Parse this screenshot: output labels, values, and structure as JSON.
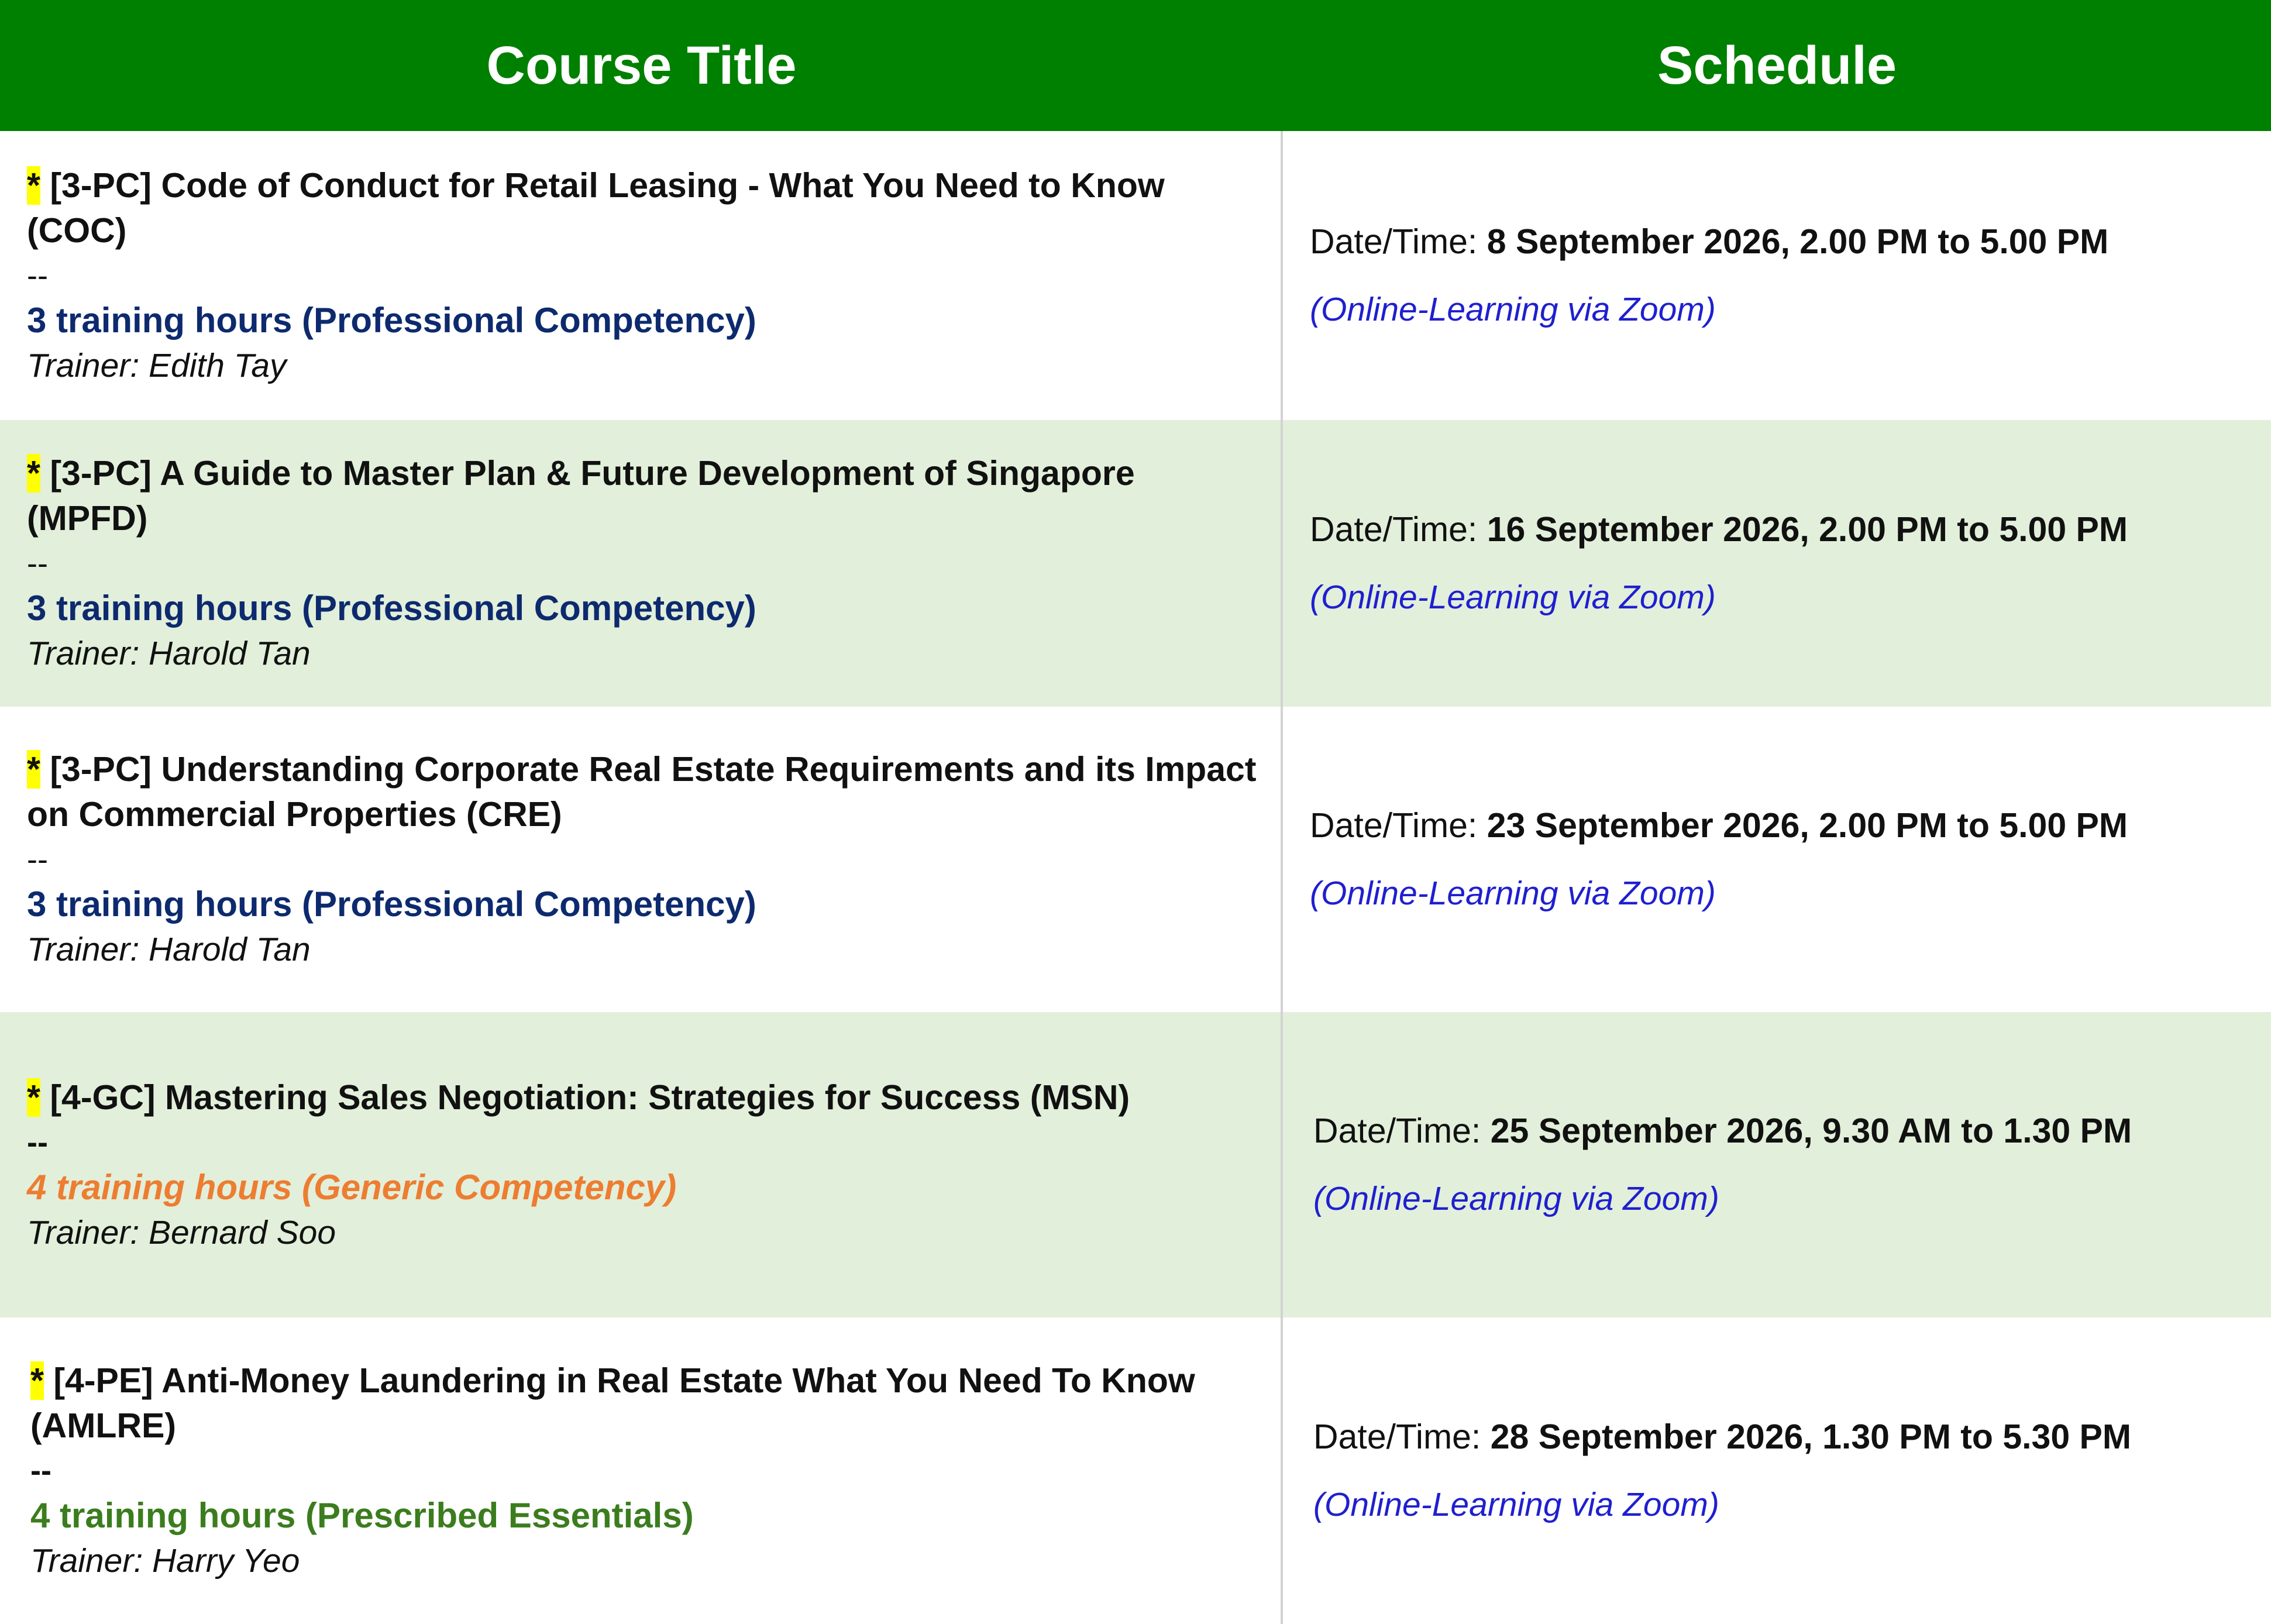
{
  "header": {
    "course_title": "Course Title",
    "schedule": "Schedule"
  },
  "colors": {
    "header_bg": "#008000",
    "alt_row_bg": "#e2efda",
    "star_highlight": "#ffff00",
    "mode_blue": "#1f1fcf"
  },
  "rows": [
    {
      "star": "*",
      "title": " [3-PC] Code of Conduct for Retail Leasing - What You Need to Know (COC)",
      "dash": "--",
      "hours": "3 training hours (Professional Competency)",
      "hours_color": "#0d2a6e",
      "trainer": "Trainer: Edith Tay",
      "datetime_label": "Date/Time: ",
      "datetime_value": "8 September 2026, 2.00 PM to 5.00 PM",
      "mode": "(Online-Learning via Zoom)"
    },
    {
      "star": "*",
      "title": " [3-PC] A Guide to Master Plan & Future Development of Singapore (MPFD)",
      "dash": "--",
      "hours": "3 training hours (Professional Competency)",
      "hours_color": "#0d2a6e",
      "trainer": "Trainer: Harold Tan",
      "datetime_label": "Date/Time: ",
      "datetime_value": "16 September 2026, 2.00 PM to 5.00 PM",
      "mode": "(Online-Learning via Zoom)"
    },
    {
      "star": "*",
      "title": " [3-PC] Understanding Corporate Real Estate Requirements and its Impact on Commercial Properties (CRE)",
      "dash": "--",
      "hours": "3 training hours (Professional Competency)",
      "hours_color": "#0d2a6e",
      "trainer": "Trainer: Harold Tan",
      "datetime_label": "Date/Time: ",
      "datetime_value": "23 September 2026, 2.00 PM to 5.00 PM",
      "mode": "(Online-Learning via Zoom)"
    },
    {
      "star": "*",
      "title": " [4-GC] Mastering Sales Negotiation: Strategies for Success (MSN)",
      "dash": "--",
      "hours": "4 training hours (Generic Competency)",
      "hours_color": "#ed7d31",
      "trainer": "Trainer: Bernard Soo",
      "datetime_label": "Date/Time: ",
      "datetime_value": "25 September 2026, 9.30 AM to 1.30 PM",
      "mode": "(Online-Learning via Zoom)"
    },
    {
      "star": "*",
      "title": " [4-PE] Anti-Money Laundering in Real Estate What You Need To Know (AMLRE)",
      "dash": "--",
      "hours": "4 training hours (Prescribed Essentials)",
      "hours_color": "#3b7d1e",
      "trainer": "Trainer: Harry Yeo",
      "datetime_label": "Date/Time: ",
      "datetime_value": "28 September 2026, 1.30 PM to 5.30 PM",
      "mode": "(Online-Learning via Zoom)"
    }
  ]
}
